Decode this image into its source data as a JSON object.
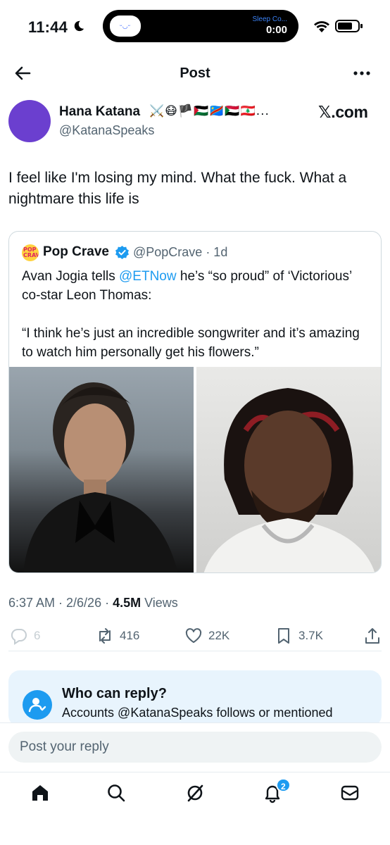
{
  "status_bar": {
    "time": "11:44",
    "live_activity_label": "Sleep Co...",
    "live_activity_timer": "0:00"
  },
  "header": {
    "title": "Post"
  },
  "post": {
    "author_name": "Hana Katana",
    "author_emoji": "⚔️😷🏴🇵🇸🇨🇩🇸🇩🇱🇧...",
    "author_handle": "@KatanaSpeaks",
    "source_badge": "𝕏.com",
    "text": "I feel like I'm losing my mind. What the fuck. What a nightmare this life is",
    "timestamp": "6:37 AM · 2/6/26 · ",
    "views_count": "4.5M",
    "views_label": " Views"
  },
  "quote": {
    "avatar_text": "POP CRAVE",
    "name": "Pop Crave",
    "handle_time": "@PopCrave · 1d",
    "text_before_link": "Avan Jogia tells ",
    "link": "@ETNow",
    "text_after_link": " he’s “so proud” of ‘Victorious’ co-star Leon Thomas:",
    "quote_line": "“I think he’s just an incredible songwriter and it’s amazing to watch him personally get his flowers.”"
  },
  "actions": {
    "replies": "6",
    "reposts": "416",
    "likes": "22K",
    "bookmarks": "3.7K"
  },
  "who_can_reply": {
    "title": "Who can reply?",
    "description": "Accounts @KatanaSpeaks follows or mentioned"
  },
  "reply": {
    "placeholder": "Post your reply"
  },
  "tab_bar": {
    "notification_count": "2"
  },
  "colors": {
    "accent": "#1d9bf0",
    "avatar": "#6b3fcf",
    "secondary_text": "#536471"
  }
}
